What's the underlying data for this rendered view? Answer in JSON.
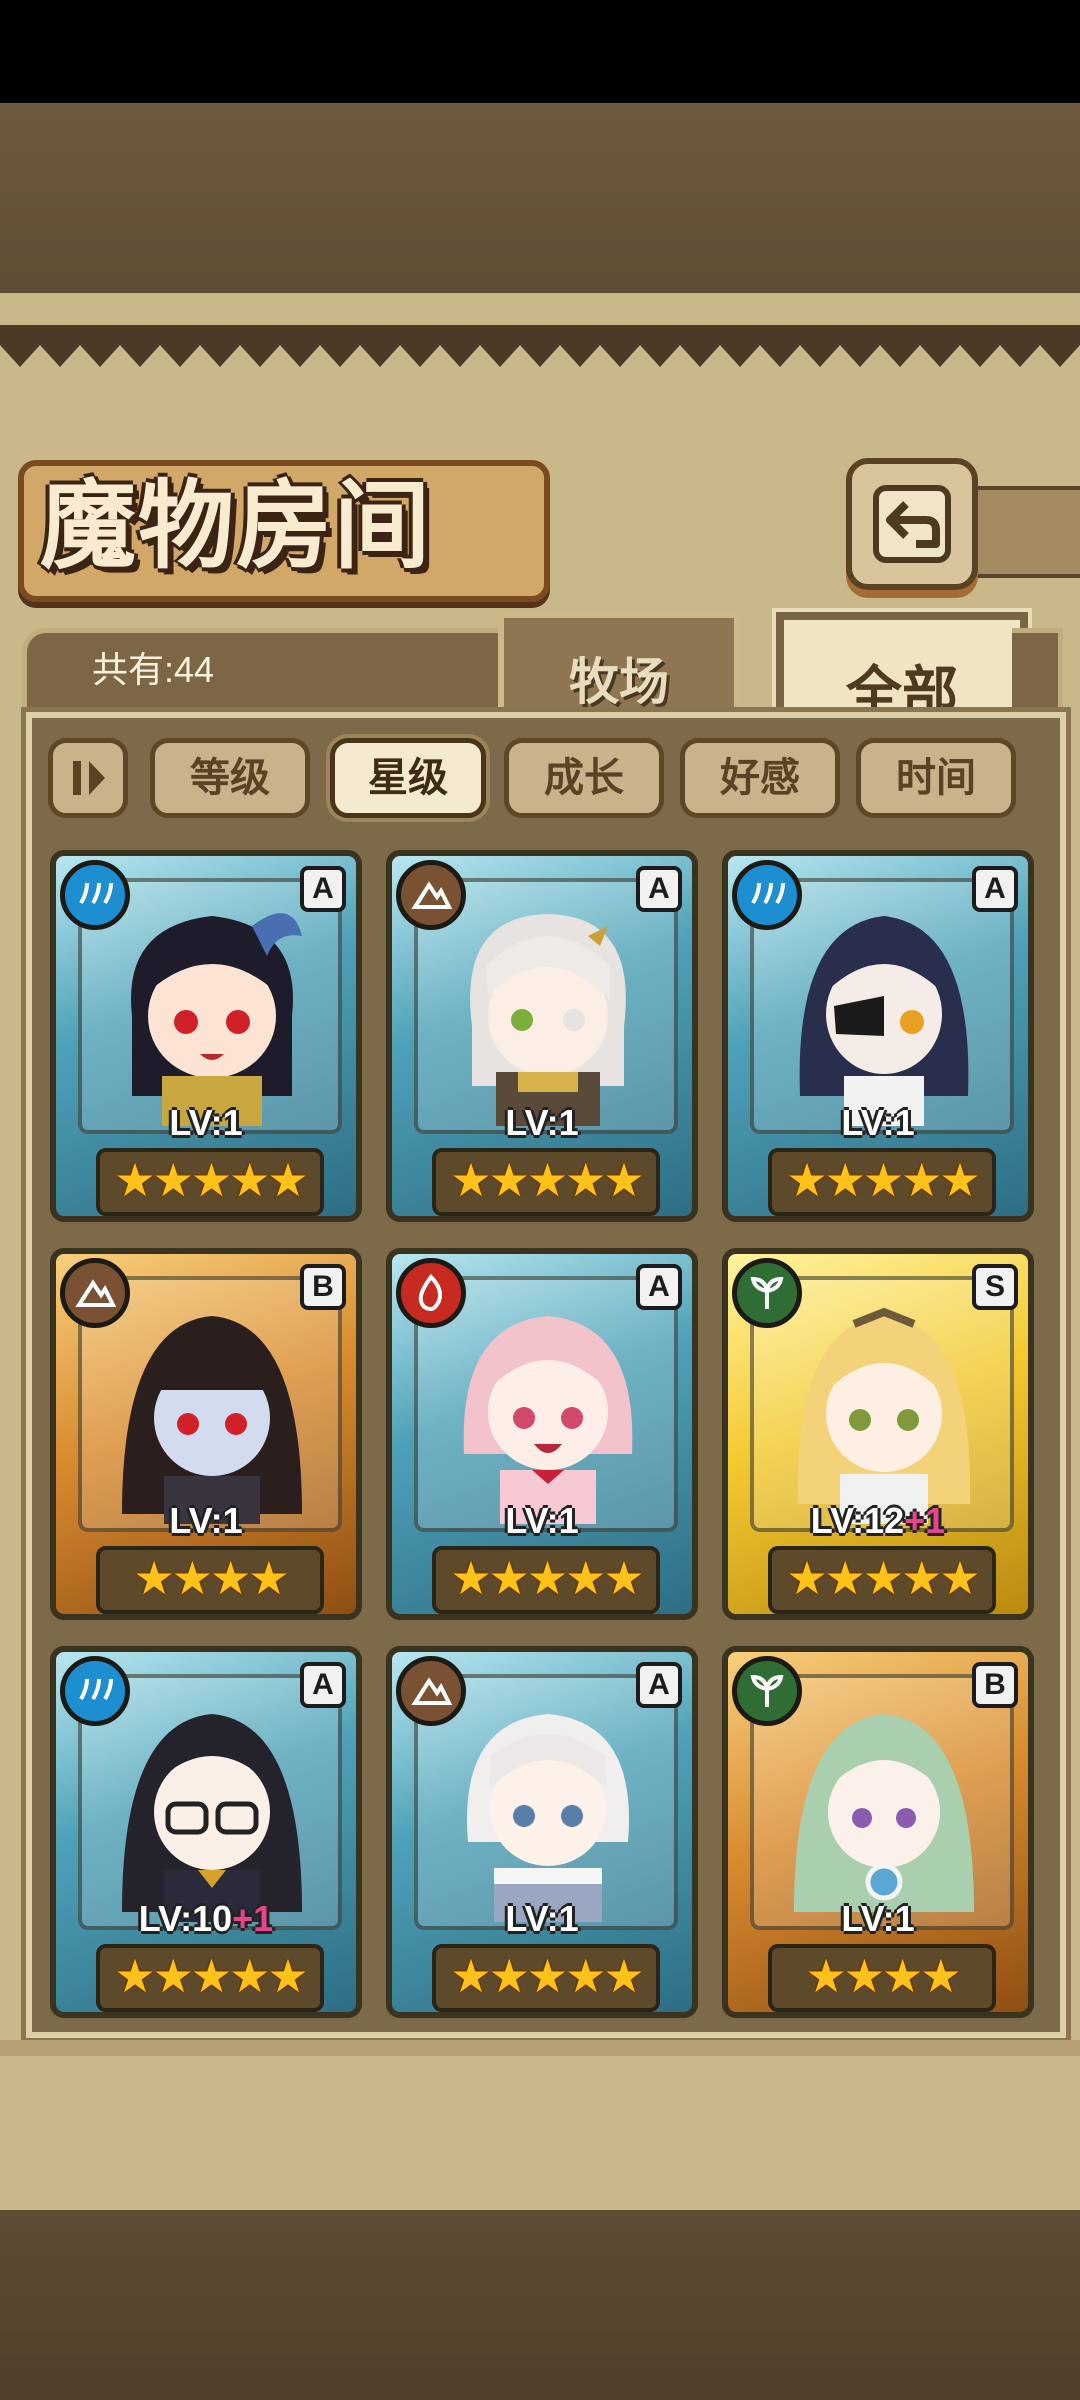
{
  "header": {
    "title": "魔物房间",
    "count_label": "共有:44",
    "tabs": [
      {
        "label": "牧场",
        "active": false
      },
      {
        "label": "全部",
        "active": true
      }
    ]
  },
  "filters": [
    {
      "label": "等级",
      "active": false
    },
    {
      "label": "星级",
      "active": true
    },
    {
      "label": "成长",
      "active": false
    },
    {
      "label": "好感",
      "active": false
    },
    {
      "label": "时间",
      "active": false
    }
  ],
  "monsters": [
    {
      "element": "water",
      "grade": "A",
      "frame": "teal",
      "level": "LV:1",
      "bonus": "",
      "stars": "★★★★★"
    },
    {
      "element": "earth",
      "grade": "A",
      "frame": "teal",
      "level": "LV:1",
      "bonus": "",
      "stars": "★★★★★"
    },
    {
      "element": "water",
      "grade": "A",
      "frame": "teal",
      "level": "LV:1",
      "bonus": "",
      "stars": "★★★★★"
    },
    {
      "element": "earth",
      "grade": "B",
      "frame": "orange",
      "level": "LV:1",
      "bonus": "",
      "stars": "★★★★"
    },
    {
      "element": "fire",
      "grade": "A",
      "frame": "teal",
      "level": "LV:1",
      "bonus": "",
      "stars": "★★★★★"
    },
    {
      "element": "wood",
      "grade": "S",
      "frame": "gold",
      "level": "LV:12",
      "bonus": "+1",
      "stars": "★★★★★"
    },
    {
      "element": "water",
      "grade": "A",
      "frame": "teal",
      "level": "LV:10",
      "bonus": "+1",
      "stars": "★★★★★"
    },
    {
      "element": "earth",
      "grade": "A",
      "frame": "teal",
      "level": "LV:1",
      "bonus": "",
      "stars": "★★★★★"
    },
    {
      "element": "wood",
      "grade": "B",
      "frame": "orange",
      "level": "LV:1",
      "bonus": "",
      "stars": "★★★★"
    }
  ],
  "colors": {
    "panel": "#c9b889",
    "frame_teal": "#4fa2b8",
    "frame_orange": "#d88a2e",
    "frame_gold": "#f3c930",
    "star": "#ffc21a",
    "bonus": "#e8438d"
  }
}
